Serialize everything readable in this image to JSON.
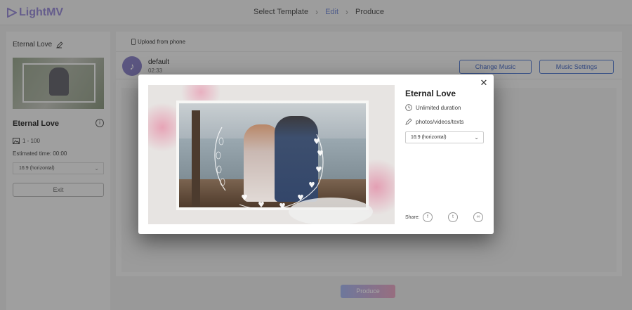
{
  "app": {
    "logo_text": "LightMV"
  },
  "steps": [
    {
      "label": "Select Template",
      "active": false
    },
    {
      "label": "Edit",
      "active": true
    },
    {
      "label": "Produce",
      "active": false
    }
  ],
  "sidebar": {
    "template_title": "Eternal Love",
    "template_name": "Eternal Love",
    "media_count": "1 - 100",
    "estimated_time": "Estimated time: 00:00",
    "aspect_ratio": "16:9 (horizontal)",
    "exit_label": "Exit"
  },
  "main": {
    "upload_label": "Upload from phone",
    "music": {
      "name": "default",
      "duration": "02:33",
      "change_label": "Change Music",
      "settings_label": "Music Settings"
    }
  },
  "footer": {
    "produce_label": "Produce"
  },
  "modal": {
    "title": "Eternal Love",
    "duration": "Unlimited duration",
    "media_types": "photos/videos/texts",
    "aspect_ratio": "16:9 (horizontal)",
    "share_label": "Share:",
    "share_icons": [
      "facebook-icon",
      "twitter-icon",
      "link-icon"
    ],
    "close_glyph": "✕"
  },
  "colors": {
    "accent": "#4f6fc4",
    "logo": "#9b8fd8",
    "produce_gradient_start": "#a8b8f0",
    "produce_gradient_end": "#e9a9c4"
  }
}
